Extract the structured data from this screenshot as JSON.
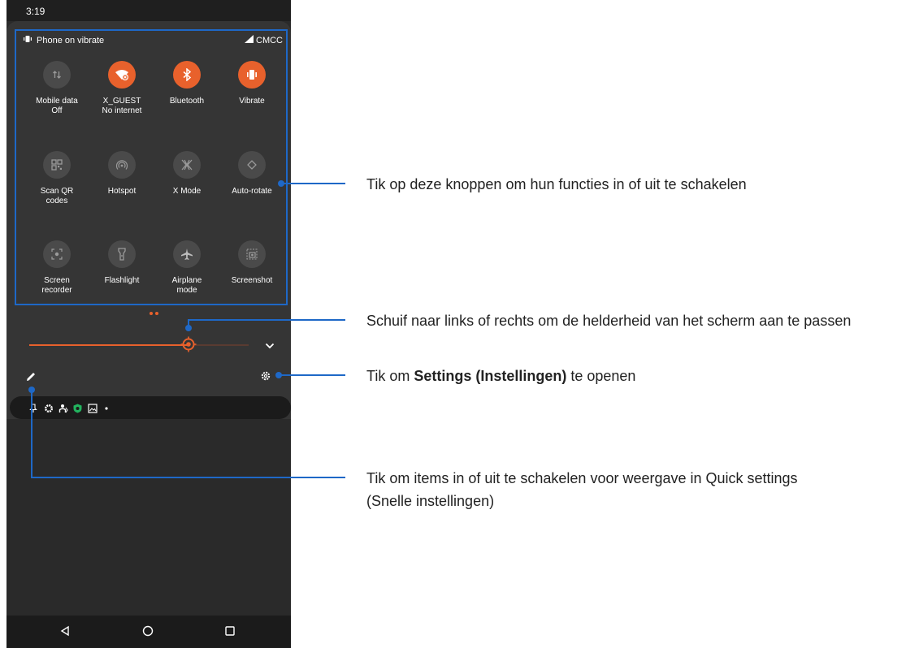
{
  "status_bar": {
    "time": "3:19"
  },
  "quick_settings": {
    "header_mode": "Phone on vibrate",
    "carrier": "CMCC",
    "tiles": [
      {
        "label": "Mobile data",
        "sub": "Off",
        "icon": "mobile-data-icon",
        "on": false
      },
      {
        "label": "X_GUEST",
        "sub": "No internet",
        "icon": "wifi-no-internet-icon",
        "on": true
      },
      {
        "label": "Bluetooth",
        "sub": "",
        "icon": "bluetooth-icon",
        "on": true
      },
      {
        "label": "Vibrate",
        "sub": "",
        "icon": "vibrate-icon",
        "on": true
      },
      {
        "label": "Scan QR\ncodes",
        "sub": "",
        "icon": "qr-code-icon",
        "on": false
      },
      {
        "label": "Hotspot",
        "sub": "",
        "icon": "hotspot-icon",
        "on": false
      },
      {
        "label": "X Mode",
        "sub": "",
        "icon": "x-mode-icon",
        "on": false
      },
      {
        "label": "Auto-rotate",
        "sub": "",
        "icon": "auto-rotate-icon",
        "on": false
      },
      {
        "label": "Screen\nrecorder",
        "sub": "",
        "icon": "screen-recorder-icon",
        "on": false
      },
      {
        "label": "Flashlight",
        "sub": "",
        "icon": "flashlight-icon",
        "on": false
      },
      {
        "label": "Airplane\nmode",
        "sub": "",
        "icon": "airplane-icon",
        "on": false
      },
      {
        "label": "Screenshot",
        "sub": "",
        "icon": "screenshot-icon",
        "on": false
      }
    ],
    "brightness_level": 0.74,
    "accent": "#e8612c",
    "callout_color": "#1e68c7"
  },
  "callouts": {
    "tiles": "Tik op deze knoppen om hun functies in of uit te schakelen",
    "brightness": "Schuif naar links of rechts om de helderheid van het scherm aan te passen",
    "settings_pre": "Tik om ",
    "settings_bold": "Settings (Instellingen)",
    "settings_post": " te openen",
    "edit_line1": "Tik om items in of uit te schakelen voor weergave in Quick settings",
    "edit_line2": "(Snelle instellingen)"
  }
}
